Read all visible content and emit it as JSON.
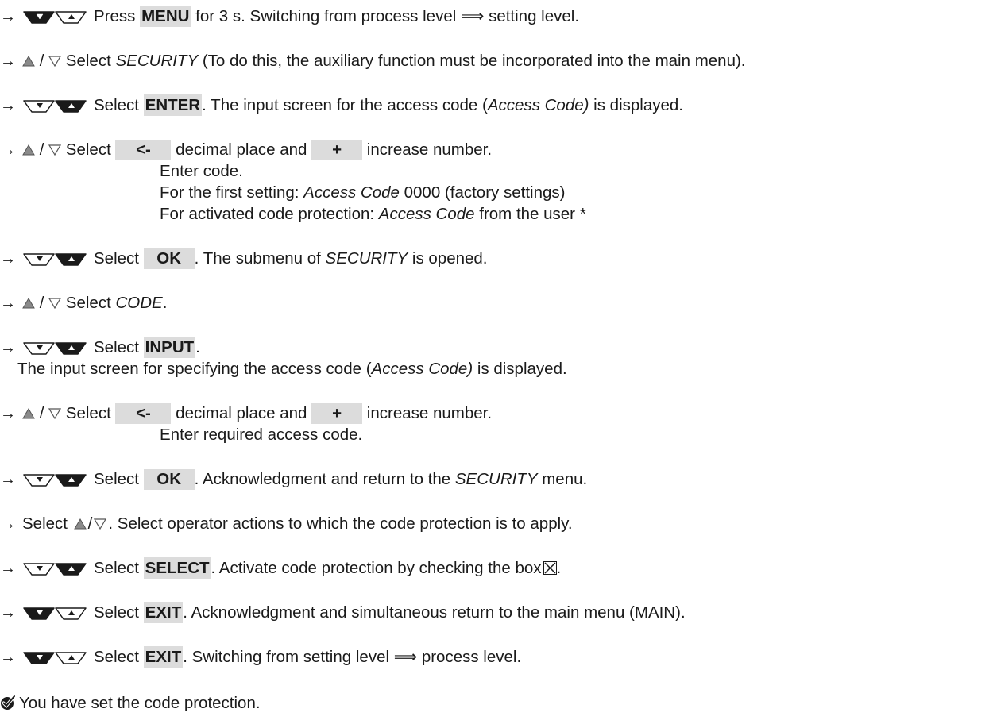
{
  "steps": [
    {
      "keys": "lightbdark",
      "parts": [
        "Press ",
        "MENU",
        " for 3 s. Switching from process level ",
        "⟹",
        " setting level."
      ]
    },
    {
      "parts": [
        "Select ",
        "SECURITY",
        " (To do this, the auxiliary function must be incorporated into the main menu)."
      ]
    },
    {
      "keys": "bothdark",
      "parts": [
        "Select ",
        "ENTER",
        ". The input screen for the access code (",
        "Access Code)",
        " is displayed."
      ]
    },
    {
      "parts": [
        "Select ",
        "<-",
        " decimal place and ",
        "+",
        " increase number."
      ],
      "sub": [
        "Enter code.",
        "For the first setting: ",
        "Access Code",
        " 0000 (factory settings)",
        "For activated code protection: ",
        "Access Code",
        " from the user *"
      ]
    },
    {
      "keys": "bothdark",
      "parts": [
        "Select ",
        "OK",
        ". The submenu of ",
        "SECURITY",
        " is opened."
      ]
    },
    {
      "parts": [
        "Select ",
        "CODE",
        "."
      ]
    },
    {
      "keys": "bothdark",
      "parts": [
        "Select ",
        "INPUT",
        "."
      ],
      "sub": [
        "The input screen for specifying the access code (",
        "Access Code)",
        " is displayed."
      ]
    },
    {
      "parts": [
        "Select ",
        "<-",
        " decimal place and ",
        "+",
        " increase number."
      ],
      "sub": [
        "Enter required access code."
      ]
    },
    {
      "keys": "bothdark",
      "parts": [
        "Select ",
        "OK",
        ". Acknowledgment and return to the ",
        "SECURITY",
        " menu."
      ]
    },
    {
      "parts": [
        "Select ",
        "/",
        ". Select operator actions to which the code protection is to apply."
      ]
    },
    {
      "keys": "bothdark",
      "parts": [
        "Select ",
        "SELECT",
        ". Activate code protection by checking the box",
        "."
      ]
    },
    {
      "keys": "leftdark",
      "parts": [
        "Select ",
        "EXIT",
        ". Acknowledgment and simultaneous return to the main menu (MAIN)."
      ]
    },
    {
      "keys": "leftdark",
      "parts": [
        "Select ",
        "EXIT",
        ". Switching from setting level ",
        "⟹",
        " process level."
      ]
    }
  ],
  "result": "You have set the code protection.",
  "arrow": "→",
  "slash": " / "
}
